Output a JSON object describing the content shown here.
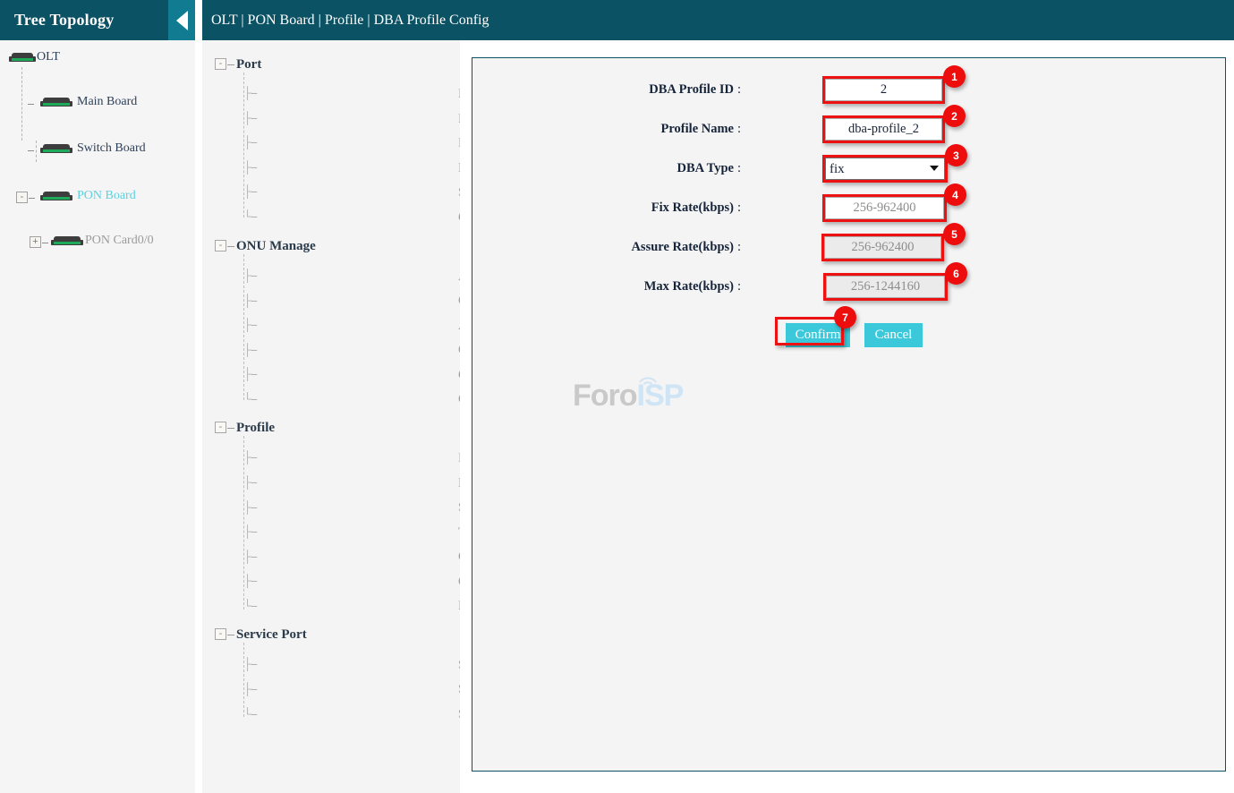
{
  "sidebar": {
    "title": "Tree Topology",
    "collapse_icon": "triangle-left-icon",
    "tree": [
      {
        "label": "OLT",
        "icon": "board-icon",
        "state": "dark",
        "toggle": null
      },
      {
        "label": "Main Board",
        "icon": "board-icon",
        "state": "dark",
        "toggle": null
      },
      {
        "label": "Switch Board",
        "icon": "board-icon",
        "state": "dark",
        "toggle": null
      },
      {
        "label": "PON Board",
        "icon": "board-icon",
        "state": "link",
        "toggle": "-"
      },
      {
        "label": "PON Card0/0",
        "icon": "board-icon",
        "state": "gray",
        "toggle": "+"
      }
    ]
  },
  "header": {
    "breadcrumb": "OLT | PON Board | Profile | DBA Profile Config"
  },
  "menu": {
    "groups": [
      {
        "title": "Port",
        "toggle": "-",
        "items": [
          {
            "label": "Port Info",
            "active": false
          },
          {
            "label": "Port Config",
            "active": false
          },
          {
            "label": "Port Extend Config",
            "active": false
          },
          {
            "label": "Port Rate Limit",
            "active": false
          },
          {
            "label": "Storm Control",
            "active": false
          },
          {
            "label": "Optical Parameter",
            "active": false
          }
        ]
      },
      {
        "title": "ONU Manage",
        "toggle": "-",
        "items": [
          {
            "label": "Authentication Control",
            "active": false
          },
          {
            "label": "ONU Authentication Config",
            "active": false
          },
          {
            "label": "Auto Find List",
            "active": false
          },
          {
            "label": "ONU Policy Auth",
            "active": false
          },
          {
            "label": "ONU Info List",
            "active": false
          },
          {
            "label": "ONU Optical Parameter",
            "active": false
          }
        ]
      },
      {
        "title": "Profile",
        "toggle": "-",
        "items": [
          {
            "label": "DBA Profile Config",
            "active": true
          },
          {
            "label": "Line Profile Config",
            "active": false
          },
          {
            "label": "Service Profile Config",
            "active": false
          },
          {
            "label": "Traffic Profile Config",
            "active": false
          },
          {
            "label": "ONU IGMP Profile",
            "active": false
          },
          {
            "label": "ONU Multicast ACL",
            "active": false
          },
          {
            "label": "Pon Protect Config",
            "active": false
          }
        ]
      },
      {
        "title": "Service Port",
        "toggle": "-",
        "items": [
          {
            "label": "Service Port Config",
            "active": false
          },
          {
            "label": "Service Port Cur Perf",
            "active": false
          },
          {
            "label": "Service Port Auto Config",
            "active": false
          }
        ]
      }
    ]
  },
  "form": {
    "fields": [
      {
        "label": "DBA Profile ID",
        "colon": ":",
        "type": "text",
        "value": "2",
        "placeholder": "",
        "disabled": false,
        "badge": "1"
      },
      {
        "label": "Profile Name",
        "colon": ":",
        "type": "text",
        "value": "dba-profile_2",
        "placeholder": "",
        "disabled": false,
        "badge": "2"
      },
      {
        "label": "DBA Type",
        "colon": ":",
        "type": "select",
        "value": "fix",
        "options": [
          "fix"
        ],
        "disabled": false,
        "badge": "3"
      },
      {
        "label": "Fix Rate(kbps)",
        "colon": ":",
        "type": "text",
        "value": "",
        "placeholder": "256-962400",
        "disabled": false,
        "badge": "4"
      },
      {
        "label": "Assure Rate(kbps)",
        "colon": ":",
        "type": "text",
        "value": "",
        "placeholder": "256-962400",
        "disabled": true,
        "badge": "5"
      },
      {
        "label": "Max Rate(kbps)",
        "colon": ":",
        "type": "text",
        "value": "",
        "placeholder": "256-1244160",
        "disabled": true,
        "badge": "6"
      }
    ],
    "confirm_label": "Confirm",
    "cancel_label": "Cancel",
    "confirm_badge": "7"
  },
  "watermark": {
    "text_primary": "Foro",
    "text_accent": "ISP",
    "icon": "antenna-signal-icon"
  },
  "colors": {
    "header_teal": "#0b5264",
    "collapse_teal": "#117b91",
    "accent_cyan": "#3bc8da",
    "link_cyan": "#4ec8dd",
    "annotation_red": "#ee0d0d",
    "panel_bg": "#f4f4f4"
  }
}
